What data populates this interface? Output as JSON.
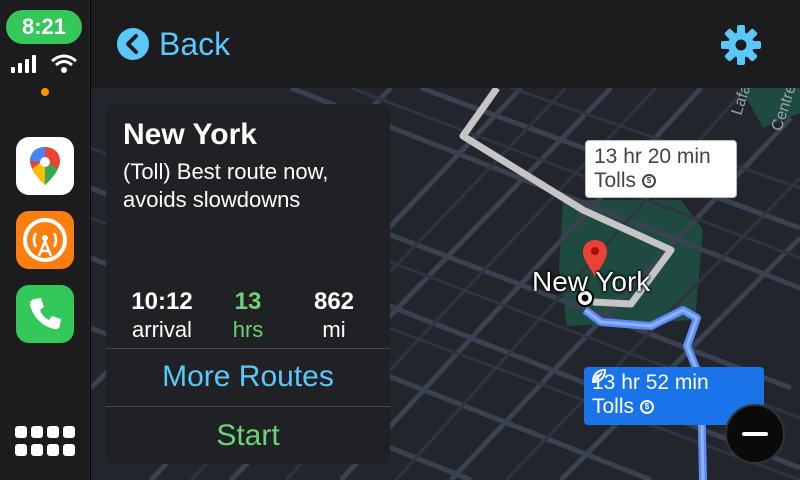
{
  "status_bar": {
    "time": "8:21"
  },
  "dock": {
    "apps": [
      {
        "icon": "google-maps-icon"
      },
      {
        "icon": "overcast-icon"
      },
      {
        "icon": "phone-icon"
      }
    ],
    "home_icon": "app-grid-icon"
  },
  "header": {
    "back_label": "Back",
    "settings_icon": "gear-icon"
  },
  "map": {
    "city_label": "New York",
    "street_labels": [
      "Lafa",
      "Centre"
    ],
    "alt_route_callout": {
      "duration": "13 hr 20 min",
      "tolls": "Tolls"
    },
    "main_route_callout": {
      "duration": "13 hr 52 min",
      "tolls": "Tolls"
    }
  },
  "route_card": {
    "title": "New York",
    "description": "(Toll) Best route now, avoids slowdowns",
    "stats": [
      {
        "value": "10:12",
        "unit": "arrival"
      },
      {
        "value": "13",
        "unit": "hrs"
      },
      {
        "value": "862",
        "unit": "mi"
      }
    ],
    "more_routes_label": "More Routes",
    "start_label": "Start"
  },
  "colors": {
    "accent_blue": "#5ac8fa",
    "accent_green": "#6dd372",
    "route_blue": "#1a73e8",
    "clock_green": "#34c759"
  }
}
